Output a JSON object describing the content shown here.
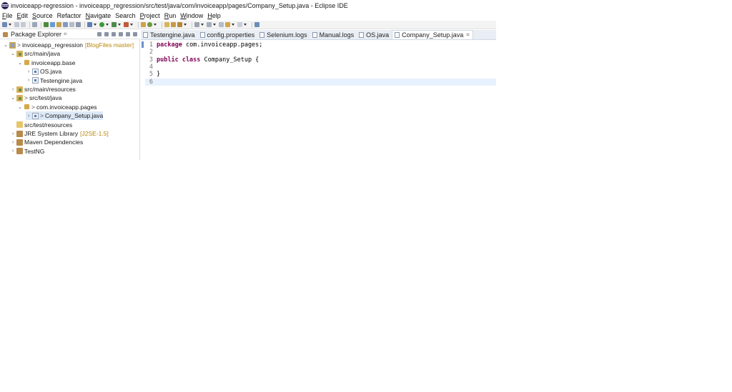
{
  "window": {
    "title": "invoiceapp-regression - invoiceapp_regression/src/test/java/com/invoiceapp/pages/Company_Setup.java - Eclipse IDE"
  },
  "menu": [
    {
      "mnemonic": "F",
      "rest": "ile"
    },
    {
      "mnemonic": "E",
      "rest": "dit"
    },
    {
      "mnemonic": "S",
      "rest": "ource"
    },
    {
      "mnemonic": "",
      "rest": "Refactor"
    },
    {
      "mnemonic": "N",
      "rest": "avigate"
    },
    {
      "mnemonic": "",
      "rest": "Search"
    },
    {
      "mnemonic": "P",
      "rest": "roject"
    },
    {
      "mnemonic": "R",
      "rest": "un"
    },
    {
      "mnemonic": "W",
      "rest": "indow"
    },
    {
      "mnemonic": "H",
      "rest": "elp"
    }
  ],
  "package_explorer": {
    "title": "Package Explorer",
    "close_glyph": "⌗",
    "tree": [
      {
        "twisty": "⌄",
        "icon": "project",
        "gt": ">",
        "label": "invoiceapp_regression",
        "decor": "[BlogFiles master]"
      },
      {
        "twisty": "⌄",
        "icon": "srcfolder",
        "gt": "",
        "label": "src/main/java",
        "decor": ""
      },
      {
        "twisty": "⌄",
        "icon": "package",
        "gt": "",
        "label": "invoiceapp.base",
        "decor": ""
      },
      {
        "twisty": "›",
        "icon": "javafile",
        "gt": "",
        "label": "OS.java",
        "decor": ""
      },
      {
        "twisty": "›",
        "icon": "javafile",
        "gt": "",
        "label": "Testengine.java",
        "decor": ""
      },
      {
        "twisty": "›",
        "icon": "srcfolder",
        "gt": "",
        "label": "src/main/resources",
        "decor": ""
      },
      {
        "twisty": "⌄",
        "icon": "srcfolder",
        "gt": ">",
        "label": "src/test/java",
        "decor": ""
      },
      {
        "twisty": "⌄",
        "icon": "package",
        "gt": ">",
        "label": "com.invoiceapp.pages",
        "decor": ""
      },
      {
        "twisty": "›",
        "icon": "javafile",
        "gt": ">",
        "label": "Company_Setup.java",
        "decor": ""
      },
      {
        "twisty": "",
        "icon": "folder",
        "gt": "",
        "label": "src/test/resources",
        "decor": ""
      },
      {
        "twisty": "›",
        "icon": "library",
        "gt": "",
        "label": "JRE System Library",
        "decor": "[J2SE-1.5]"
      },
      {
        "twisty": "›",
        "icon": "library",
        "gt": "",
        "label": "Maven Dependencies",
        "decor": ""
      },
      {
        "twisty": "›",
        "icon": "library",
        "gt": "",
        "label": "TestNG",
        "decor": ""
      }
    ]
  },
  "editor": {
    "tabs": [
      {
        "label": "Testengine.java",
        "active": false
      },
      {
        "label": "config.properties",
        "active": false
      },
      {
        "label": "Selenium.logs",
        "active": false
      },
      {
        "label": "Manual.logs",
        "active": false
      },
      {
        "label": "OS.java",
        "active": false
      },
      {
        "label": "Company_Setup.java",
        "active": true
      }
    ],
    "tab_close_glyph": "⌗",
    "lines": [
      {
        "n": "1",
        "kw": "package",
        "text": " com.invoiceapp.pages;"
      },
      {
        "n": "2",
        "kw": "",
        "text": ""
      },
      {
        "n": "3",
        "kw": "public class",
        "text": " Company_Setup {"
      },
      {
        "n": "4",
        "kw": "",
        "text": ""
      },
      {
        "n": "5",
        "kw": "",
        "text": "}"
      },
      {
        "n": "6",
        "kw": "",
        "text": ""
      }
    ]
  },
  "colors": {
    "keyword": "#7f0055",
    "current_line": "#e8f2fe",
    "selection": "#dde9f7"
  }
}
